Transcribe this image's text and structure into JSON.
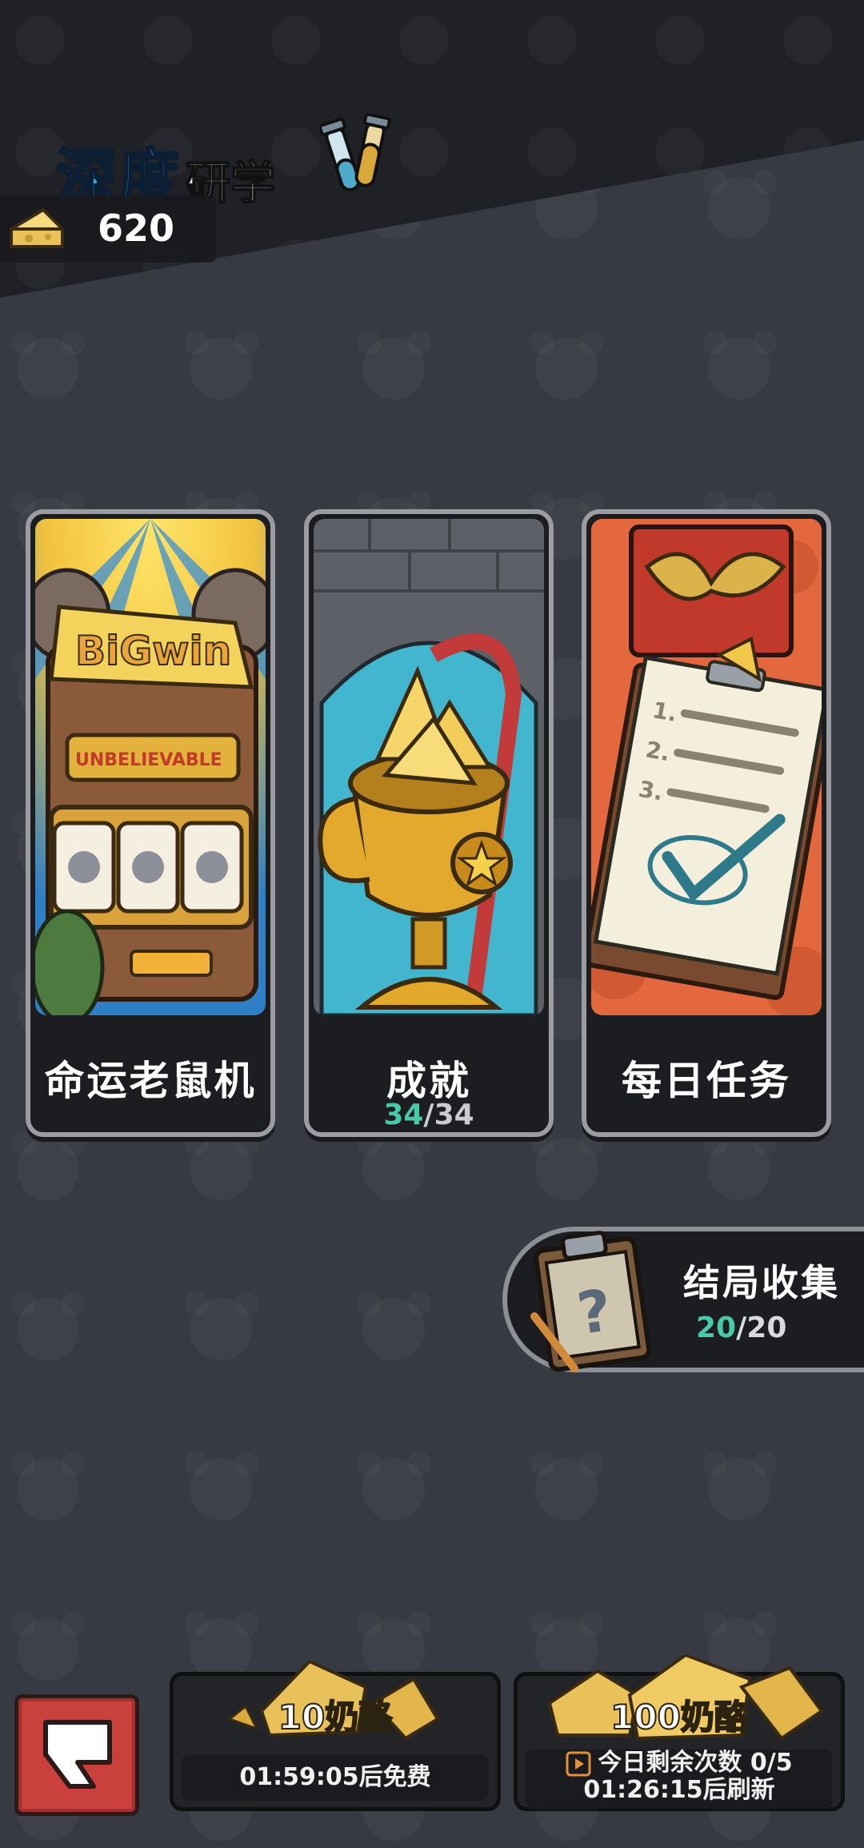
{
  "header": {
    "title_part1": "深度",
    "title_part2": "研学",
    "cheese_amount": "620"
  },
  "cards": [
    {
      "label": "命运老鼠机",
      "art_text": "BiGwin",
      "art_subtext": "UNBELIEVABLE"
    },
    {
      "label": "成就",
      "progress_current": "34",
      "progress_sep": "/",
      "progress_total": "34"
    },
    {
      "label": "每日任务"
    }
  ],
  "ending_collection": {
    "label": "结局收集",
    "progress_current": "20",
    "progress_sep": "/",
    "progress_total": "20"
  },
  "rewards": [
    {
      "title": "10奶酪",
      "subtitle": "01:59:05后免费"
    },
    {
      "title": "100奶酪",
      "subtitle_line1": "今日剩余次数 0/5",
      "subtitle_line2": "01:26:15后刷新"
    }
  ],
  "colors": {
    "background": "#373a42",
    "title_blue": "#3fa4e6",
    "progress_accent": "#48c9a9",
    "back_button_red": "#c9403d"
  },
  "icons": [
    "test-tubes-icon",
    "cheese-icon",
    "back-icon",
    "clipboard-question-icon",
    "play-icon"
  ]
}
